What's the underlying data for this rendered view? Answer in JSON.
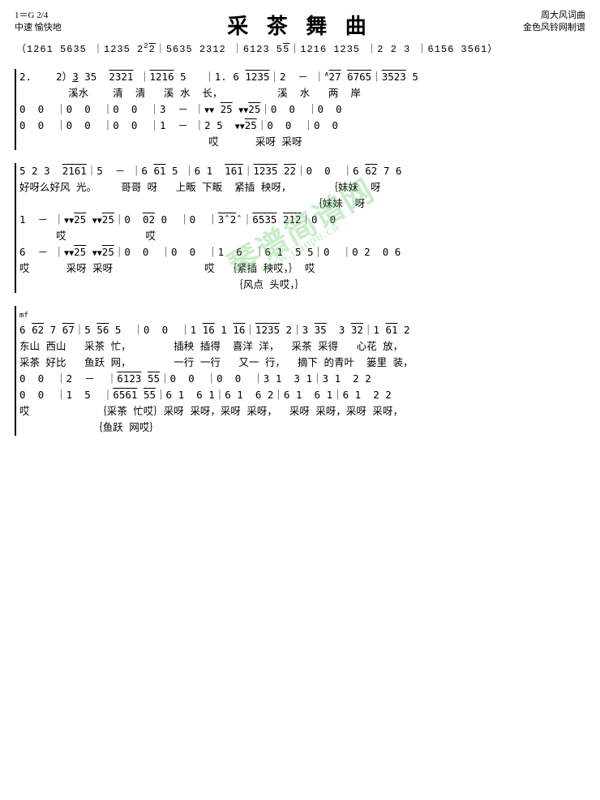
{
  "header": {
    "title": "采 茶 舞 曲",
    "top_left_line1": "1＝G  2/4",
    "top_left_line2": "中速  愉快地",
    "top_right_line1": "周大风词曲",
    "top_right_line2": "金色风铃网制谱"
  },
  "intro": "（1261 5635 | 1235 2̄2̄ | 5635 2312 | 6123 5̄5̄ | 1216 1235 | 2 2 3 | 6156 3561",
  "watermark": "琴谱简谱网",
  "watermark_url": "www.jianpu.cn",
  "sections": [
    {
      "id": "sec1",
      "lines": [
        "2.    2）3 35  2321  | 1216 5   | 1. 6 1235 | 2  -  | 2̄7̄  6765 | 3523 5",
        "      溪水    清  清   溪 水  长，     溪  水   两  岸",
        "0  0  | 0  0  | 0  0  | 3  -  | 2̄5̄  2̄5̄  | 0  0  | 0  0",
        "0  0  | 0  0  | 0  0  | 1  -  | 2 5  2̄5̄  | 0  0  | 0  0",
        "                              哎      采呀 采呀"
      ]
    },
    {
      "id": "sec2",
      "lines": [
        "5 2 3  2161 | 5  -  | 6 61 5  | 6 1  161̂  | 1235 2̄2̄ | 0  0  | 6 62 7 6",
        "好呀么好风 光。    哥哥 呀   上畈 下畈  紧插 秧呀，     妹妹  呀",
        "                                                        妹妹  呀",
        "1  -  | 2̄5̄  2̄5̄  | 0  0̂2  0  | 0  | 3̂  2̂  | 6535 212 | 0  0",
        "      哎           哎",
        "6  -  | 2̄5̄  2̄5̄  | 0  0  | 0  0  | 1  6  | 6 1  5 5 | 0  | 0 2  0 6",
        "哎      采呀 采呀               哎   紧插 秧哎，    哎  风点 头哎，  哎"
      ]
    },
    {
      "id": "sec3",
      "lines": [
        "6 62 7 67 | 5 56 5  | 0  0  | 1 16̂ 1 16 | 1235 2 | 3 35  3 32 | 1 61 2",
        "东山 西山   采茶 忙，       插秧 插得 喜洋 洋，  采茶 采得   心花 放，",
        "采茶 好比   鱼跃 网，       一行 一行  又一 行，  摘下 的青叶  篓里 装，",
        "0  0  | 2  -  | 6123 5̄5̄ | 0  0  | 0  0  | 3 1  3 1 | 3 1  2 2",
        "0  0  | 1  5  | 6561 5̄5̄ | 6 1  6 1 | 6 1  6 2 | 6 1  6 1 | 6 1  2 2",
        "哎           采茶 忙哎  采呀 采呀，采呀 采呀，  采呀 采呀，采呀 采呀，",
        "             鱼跃 网哎"
      ]
    }
  ]
}
